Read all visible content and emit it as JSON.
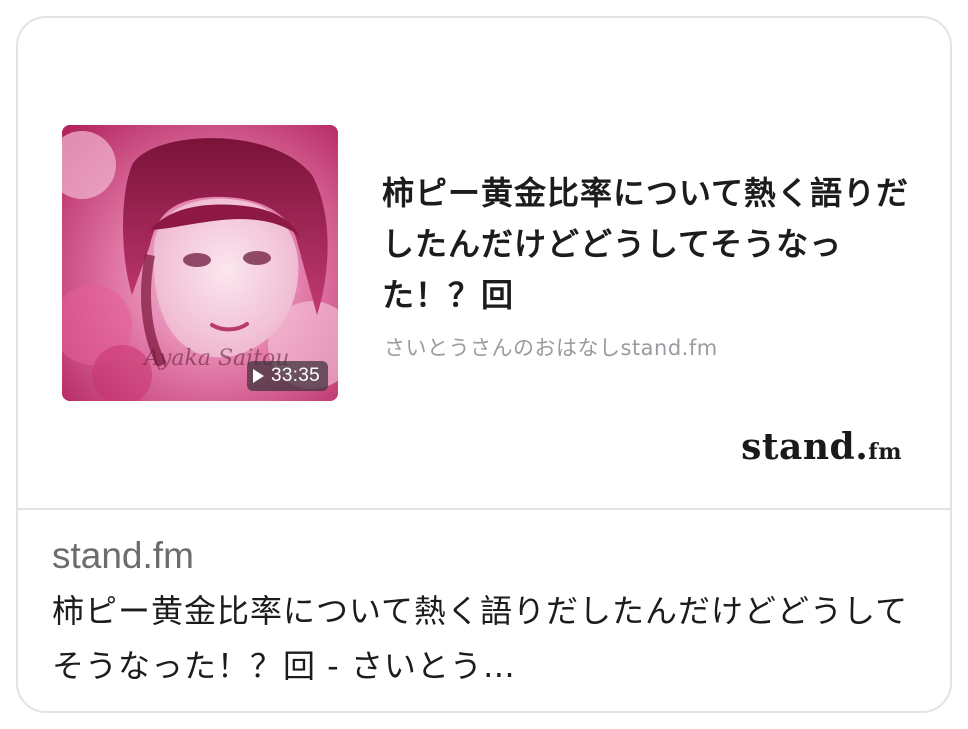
{
  "preview": {
    "episode_title": "柿ピー黄金比率について熱く語りだしたんだけどどうしてそうなった！？回",
    "channel_name": "さいとうさんのおはなしstand.fm",
    "duration": "33:35",
    "thumbnail_signature": "Ayaka Saitou",
    "brand": {
      "name": "stand.",
      "suffix": "fm"
    }
  },
  "link": {
    "domain": "stand.fm",
    "title": "柿ピー黄金比率について熱く語りだしたんだけどどうしてそうなった！？回 - さいとう…"
  },
  "colors": {
    "thumbnail_accent": "#d14e86",
    "title_text": "#1c1c1e",
    "muted_text": "#9a9aa0",
    "border": "#e3e3e6"
  }
}
